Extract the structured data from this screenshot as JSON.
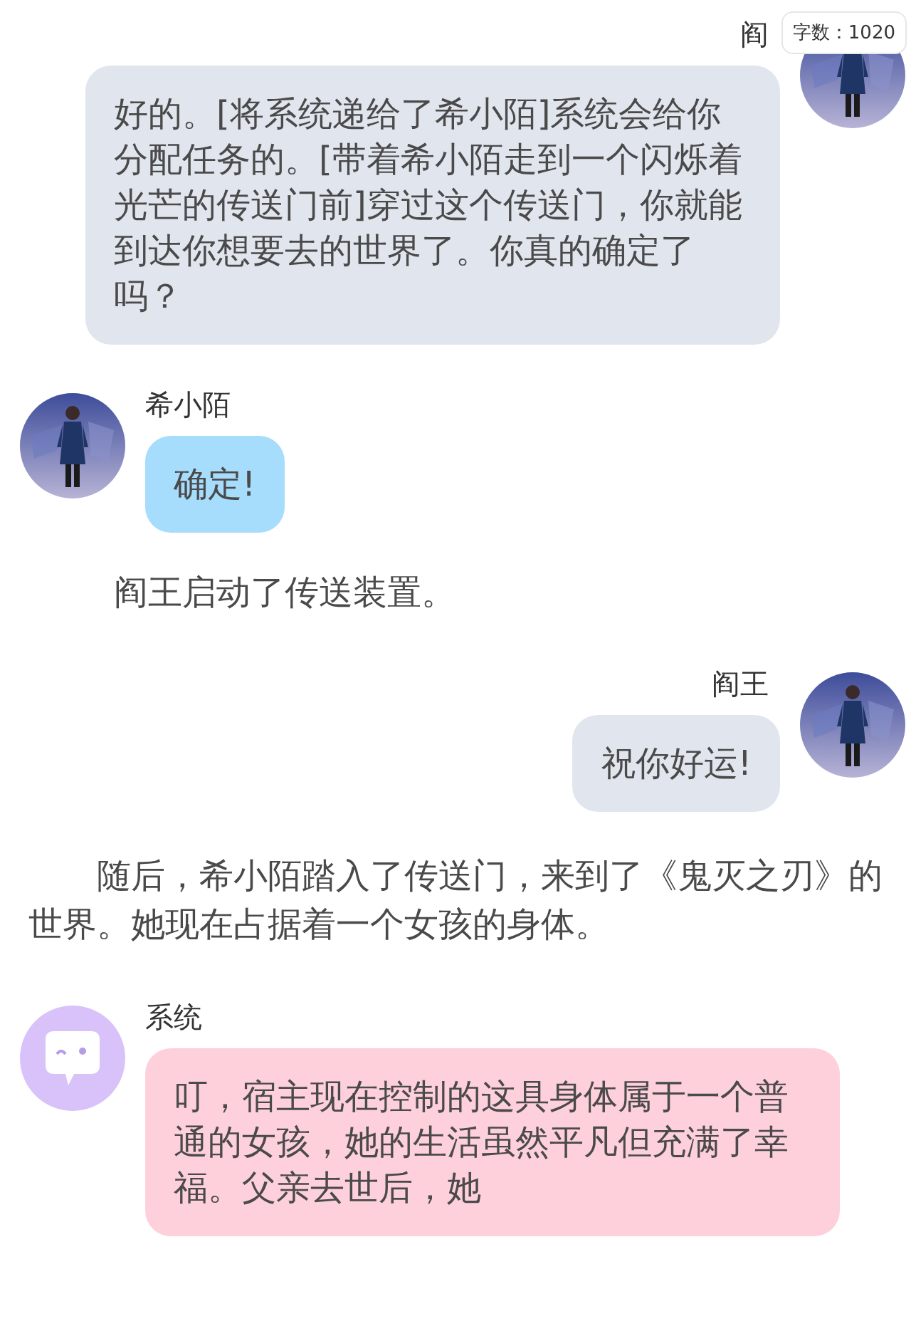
{
  "word_count": "字数：1020",
  "items": [
    {
      "kind": "right",
      "sender": "阎",
      "text": "好的。[将系统递给了希小陌]系统会给你分配任务的。[带着希小陌走到一个闪烁着光芒的传送门前]穿过这个传送门，你就能到达你想要去的世界了。你真的确定了吗？",
      "color": "#e1e5ee"
    },
    {
      "kind": "left",
      "sender": "希小陌",
      "text": "确定!",
      "color": "#a6dcfc"
    },
    {
      "kind": "narration",
      "text": "阎王启动了传送装置。",
      "indent": false
    },
    {
      "kind": "right",
      "sender": "阎王",
      "text": "祝你好运!",
      "color": "#e1e5ee"
    },
    {
      "kind": "narration",
      "text": "随后，希小陌踏入了传送门，来到了《鬼灭之刃》的世界。她现在占据着一个女孩的身体。",
      "indent": true
    },
    {
      "kind": "left",
      "sender": "系统",
      "avatar": {
        "kind": "icon"
      },
      "text": "叮，宿主现在控制的这具身体属于一个普通的女孩，她的生活虽然平凡但充满了幸福。父亲去世后，她",
      "color": "#fdd0dc"
    }
  ]
}
